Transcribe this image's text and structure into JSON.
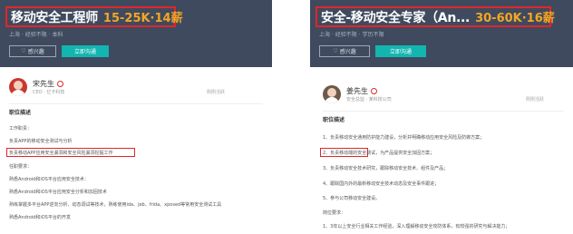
{
  "left": {
    "title": "移动安全工程师",
    "salary": "15-25K·14薪",
    "subinfo": "上海 · 经验不限 · 本科",
    "follow_label": "感兴趣",
    "chat_label": "立即沟通",
    "recruiter_name": "宋先生",
    "recruiter_role": "CEO · 亿卡科技",
    "right_meta": "刚刚活跃",
    "section_heading": "职位描述",
    "lines": [
      "工作职责：",
      "负责APP的移动安全测试与分析",
      "负责移动APP应用安全漏洞和安全风险漏洞挖掘工作",
      "任职要求：",
      "熟悉Android和iOS平台应用安全技术：",
      "熟悉Android和iOS平台应用安全分析和加固技术",
      "熟练掌握多平台APP逆向分析、动态调试等技术，熟练使用ida、jeb、frida、xposed等常用安全测试工具",
      "熟悉Android和iOS平台的开发"
    ]
  },
  "right": {
    "title": "安全-移动安全专家（An...",
    "salary": "30-60K·16薪",
    "subinfo": "上海 · 经验不限 · 学历不限",
    "follow_label": "感兴趣",
    "chat_label": "立即沟通",
    "recruiter_name": "姜先生",
    "recruiter_role": "安全总监 · 某科技公司",
    "right_meta": "刚刚活跃",
    "section_heading": "职位描述",
    "lines": [
      "1、负责移动安全通用防护能力建设，分析并明确移动应用安全风险及防御方案；",
      "2、负责移动端的安全测试，为产品提供安全加固方案；",
      "3、负责移动安全技术研究，跟踪移动安全技术、组件及产品；",
      "4、跟踪国内外的最新移动安全技术动态及安全事件跟进；",
      "5、参与公司移动安全建设。",
      "岗位要求：",
      "1、3年以上安全行业相关工作经验，深入理解移动安全攻防体系，有较强的研究与解决能力；"
    ]
  }
}
